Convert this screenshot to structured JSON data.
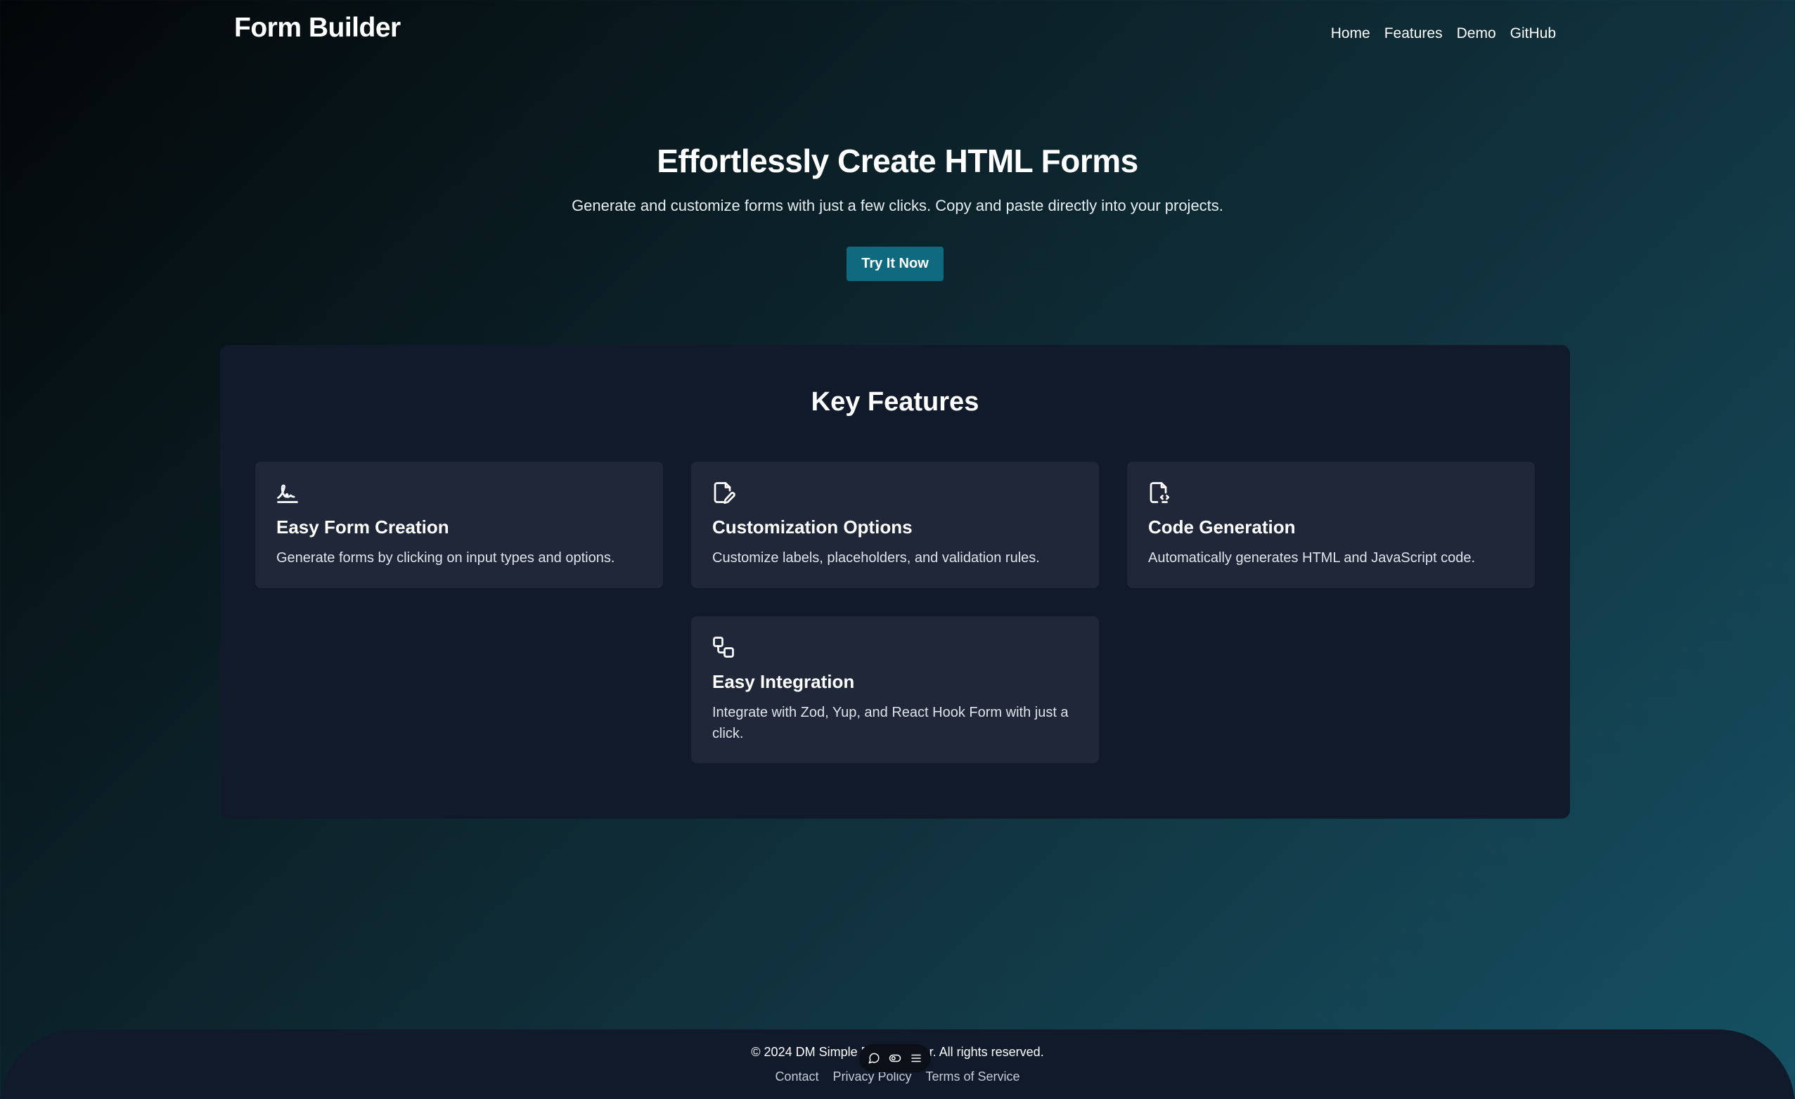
{
  "header": {
    "logo": "Form Builder",
    "nav": [
      "Home",
      "Features",
      "Demo",
      "GitHub"
    ]
  },
  "hero": {
    "title": "Effortlessly Create HTML Forms",
    "subtitle": "Generate and customize forms with just a few clicks. Copy and paste directly into your projects.",
    "cta_label": "Try It Now"
  },
  "features": {
    "title": "Key Features",
    "items": [
      {
        "icon": "signature-icon",
        "title": "Easy Form Creation",
        "description": "Generate forms by clicking on input types and options."
      },
      {
        "icon": "file-edit-icon",
        "title": "Customization Options",
        "description": "Customize labels, placeholders, and validation rules."
      },
      {
        "icon": "file-code-icon",
        "title": "Code Generation",
        "description": "Automatically generates HTML and JavaScript code."
      },
      {
        "icon": "workflow-icon",
        "title": "Easy Integration",
        "description": "Integrate with Zod, Yup, and React Hook Form with just a click."
      }
    ]
  },
  "footer": {
    "copyright": "© 2024 DM Simple Form Builder. All rights reserved.",
    "links": [
      "Contact",
      "Privacy Policy",
      "Terms of Service"
    ]
  },
  "toolbar": {
    "icons": [
      "comment-icon",
      "toggle-icon",
      "menu-icon"
    ]
  },
  "colors": {
    "accent": "#0f6a80",
    "panel": "#111a2b",
    "card": "#1f2738"
  }
}
